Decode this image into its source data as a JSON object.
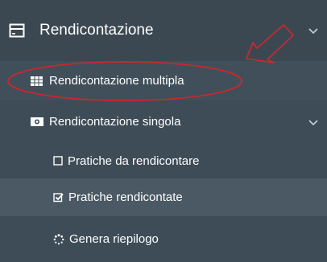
{
  "menu": {
    "section": {
      "label": "Rendicontazione",
      "icon": "credit-card-icon"
    },
    "items": [
      {
        "label": "Rendicontazione multipla",
        "icon": "grid-table-icon"
      },
      {
        "label": "Rendicontazione singola",
        "icon": "money-bill-icon"
      }
    ],
    "subitems": [
      {
        "label": "Pratiche da rendicontare",
        "icon": "empty-checkbox-icon"
      },
      {
        "label": "Pratiche rendicontate",
        "icon": "checked-checkbox-icon"
      },
      {
        "label": "Genera riepilogo",
        "icon": "spinner-icon"
      }
    ]
  },
  "colors": {
    "sidebar_bg": "#3e4c57",
    "active_row_bg": "#4a5964",
    "annotation_red": "#c8282e",
    "text": "#ffffff"
  }
}
